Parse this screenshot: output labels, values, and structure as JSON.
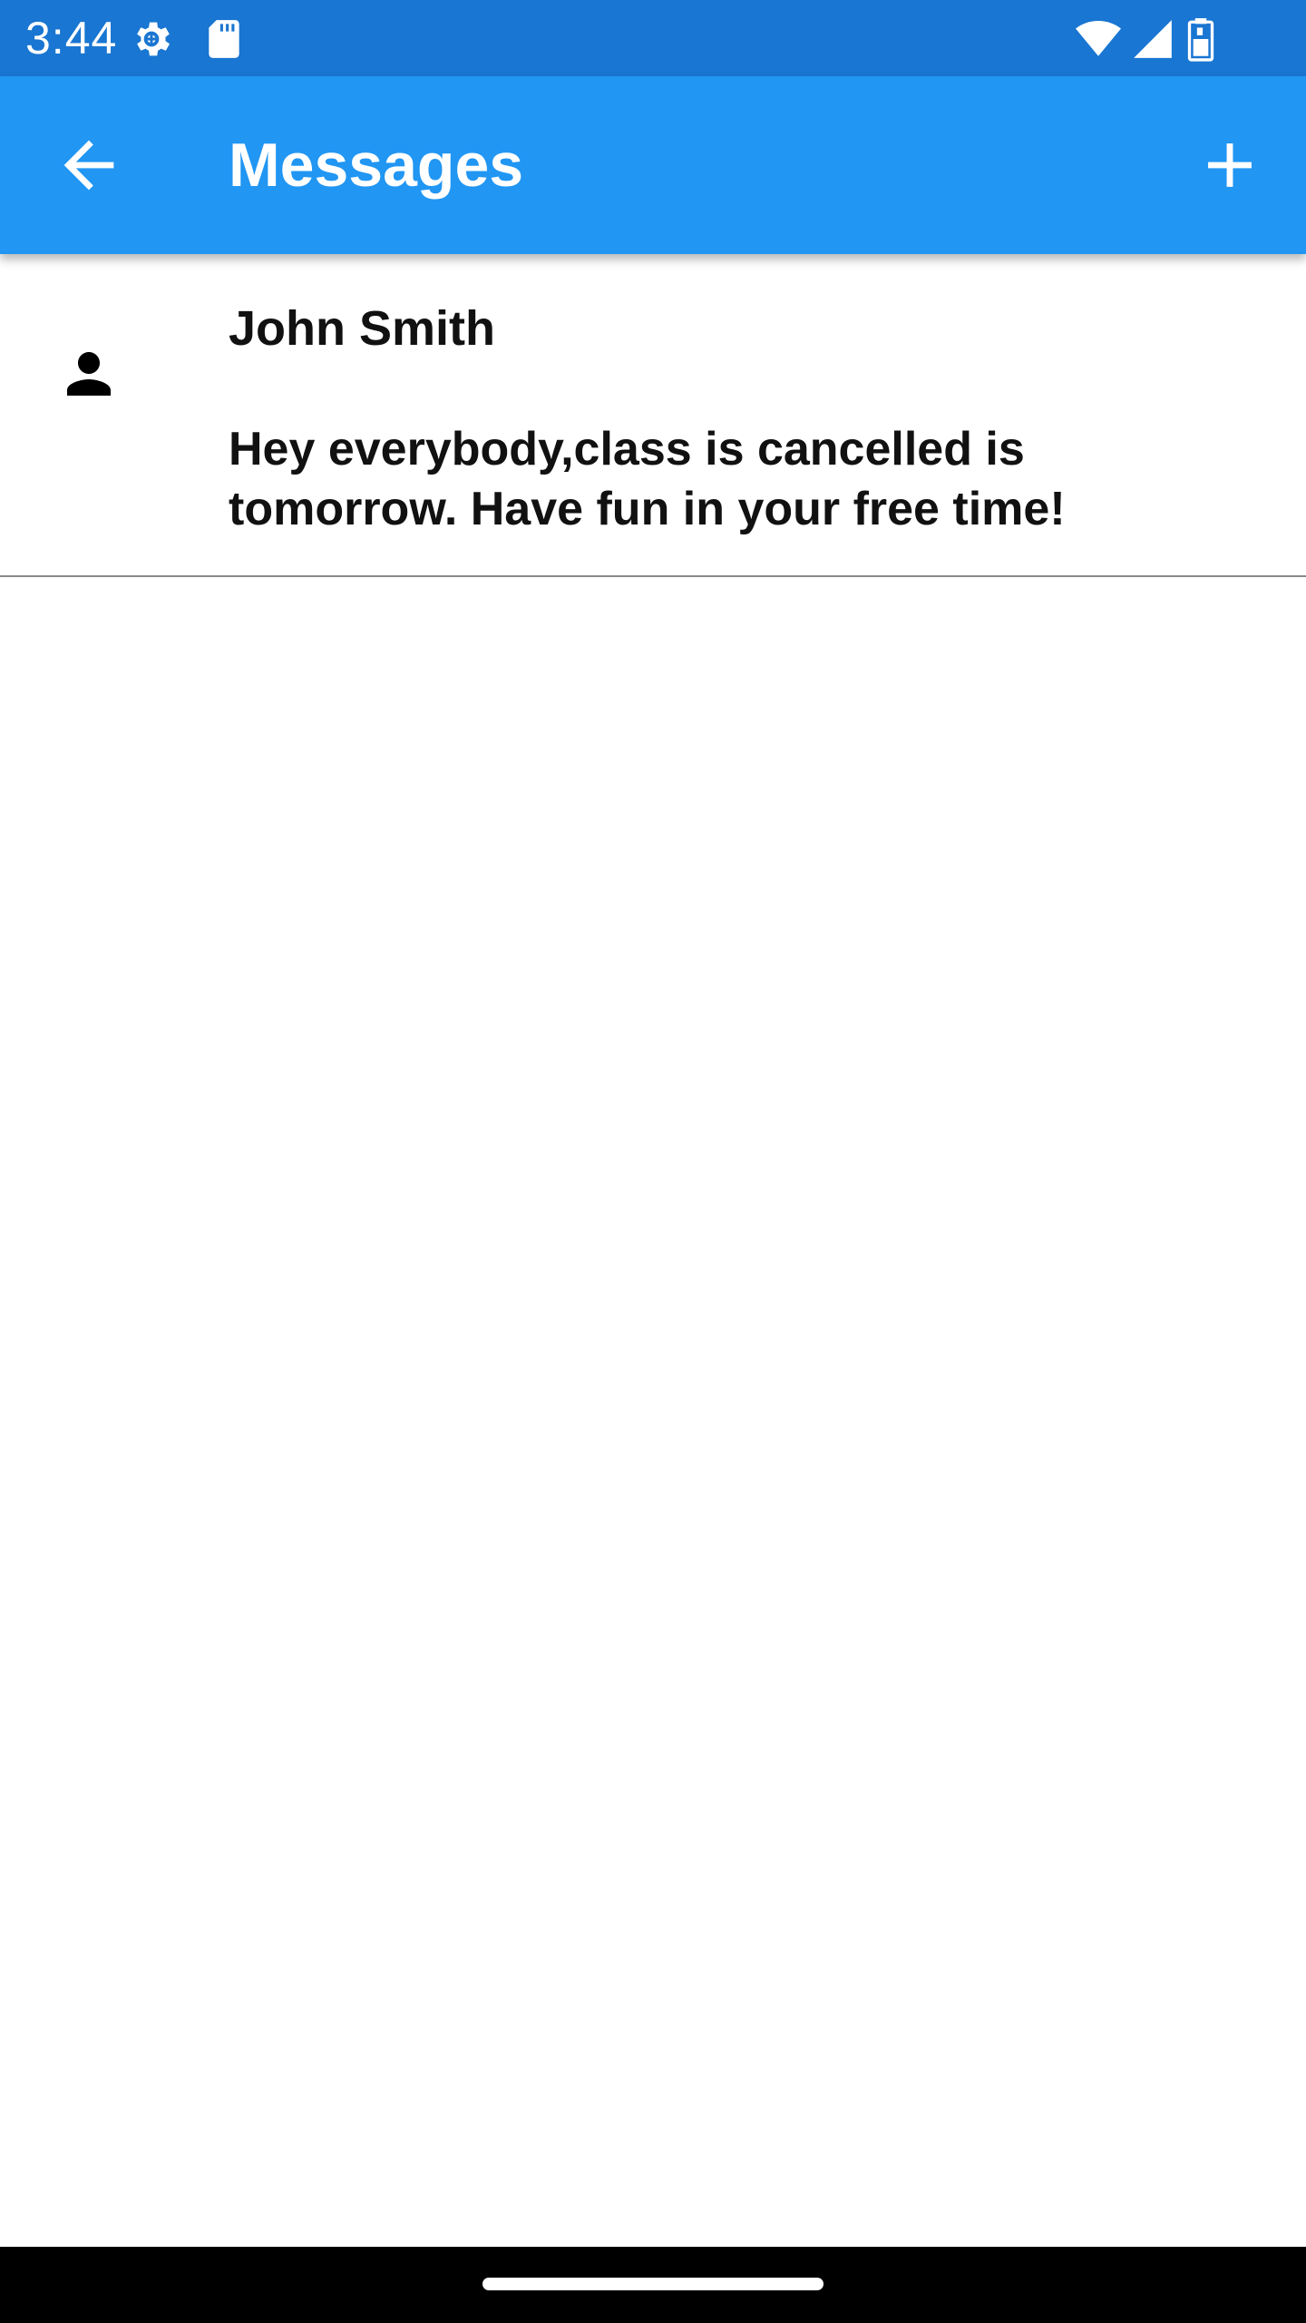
{
  "status_bar": {
    "time": "3:44",
    "icons": [
      "settings-icon",
      "sd-card-icon",
      "wifi-icon",
      "cell-signal-icon",
      "battery-icon"
    ],
    "color": "#1976D2"
  },
  "app_bar": {
    "title": "Messages",
    "back_icon": "arrow-back-icon",
    "add_icon": "plus-icon",
    "color": "#2196F3"
  },
  "messages": [
    {
      "sender": "John Smith",
      "body": "Hey everybody,class is cancelled is tomorrow. Have fun in your free time!",
      "avatar_icon": "person-icon"
    }
  ],
  "nav_bar": {
    "color": "#000000"
  }
}
